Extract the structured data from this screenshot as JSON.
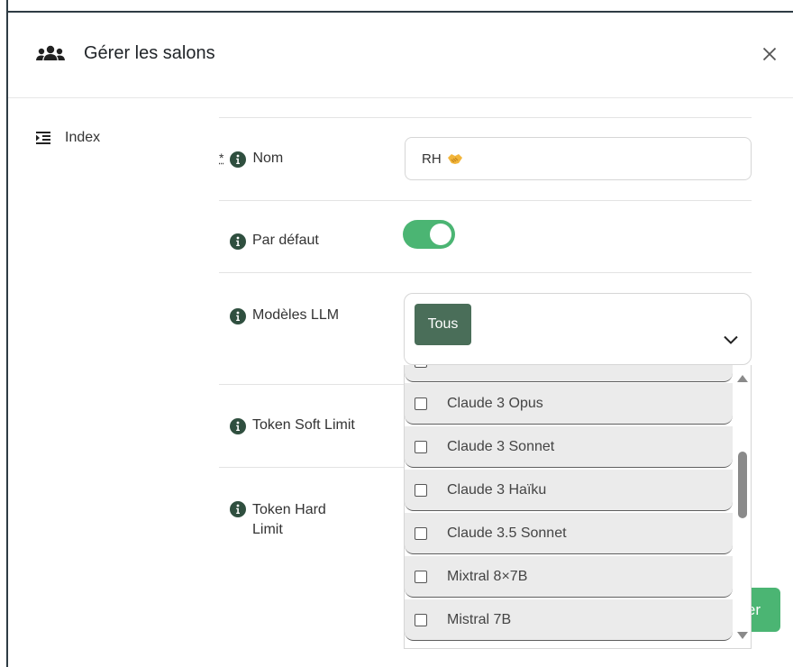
{
  "modal": {
    "title": "Gérer les salons",
    "header_icon": "users-icon",
    "close_icon": "close-icon"
  },
  "sidebar": {
    "items": [
      {
        "label": "Index",
        "icon": "list-indent-icon"
      }
    ]
  },
  "form": {
    "required_marker": "*",
    "nom": {
      "label": "Nom",
      "value": "RH",
      "emoji": "handshake-emoji"
    },
    "par_defaut": {
      "label": "Par défaut",
      "checked": true
    },
    "modeles": {
      "label": "Modèles LLM",
      "selected_chip": "Tous",
      "options": [
        {
          "label": "Claude 3 Opus",
          "checked": false
        },
        {
          "label": "Claude 3 Sonnet",
          "checked": false
        },
        {
          "label": "Claude 3 Haïku",
          "checked": false
        },
        {
          "label": "Claude 3.5 Sonnet",
          "checked": false
        },
        {
          "label": "Mixtral 8×7B",
          "checked": false
        },
        {
          "label": "Mistral 7B",
          "checked": false
        }
      ]
    },
    "token_soft": {
      "label": "Token Soft Limit"
    },
    "token_hard": {
      "label_line1": "Token Hard",
      "label_line2": "Limit"
    }
  },
  "footer": {
    "button_partial_label": "er"
  },
  "colors": {
    "accent_green": "#4bb573",
    "chip_green": "#4a6e59",
    "info_icon": "#2f4f3f"
  }
}
